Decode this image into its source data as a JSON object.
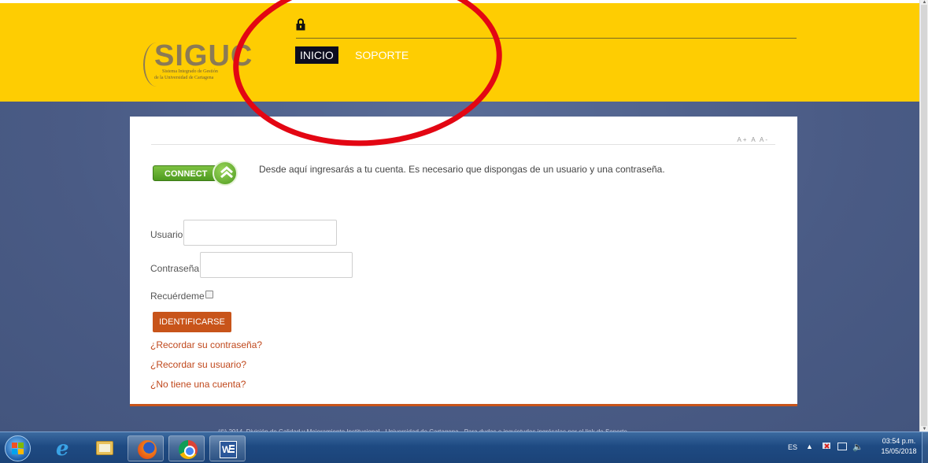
{
  "header": {
    "logo_text": "SIGUC",
    "logo_subtitle_1": "Sistema Integrado de Gestión",
    "logo_subtitle_2": "de la Universidad de Cartagena",
    "nav": {
      "inicio": "INICIO",
      "soporte": "SOPORTE"
    }
  },
  "card": {
    "font_size_controls": "A+ A A-",
    "connect_label": "CONNECT",
    "intro": "Desde aquí ingresarás a tu cuenta. Es necesario que dispongas de un usuario y una contraseña.",
    "username_label": "Usuario",
    "username_value": "",
    "password_label": "Contraseña",
    "password_value": "",
    "remember_label": "Recuérdeme",
    "remember_checked": false,
    "login_button": "IDENTIFICARSE",
    "links": {
      "forgot_password": "¿Recordar su contraseña?",
      "forgot_username": "¿Recordar su usuario?",
      "no_account": "¿No tiene una cuenta?"
    }
  },
  "footer": "(©) 2014. División de Calidad y Mejoramiento Institucional - Universidad de Cartagena - Para dudas e inquietudes ingrésalas por el link de Soporte.",
  "annotation_color": "#e30613",
  "colors": {
    "header_bg": "#fecd02",
    "accent": "#c8541a",
    "background": "#4f6390"
  },
  "taskbar": {
    "apps": [
      "start-icon",
      "internet-explorer-icon",
      "file-explorer-icon",
      "firefox-icon",
      "chrome-icon",
      "word-icon"
    ],
    "tray": {
      "language": "ES",
      "time": "03:54 p.m.",
      "date": "15/05/2018"
    }
  }
}
